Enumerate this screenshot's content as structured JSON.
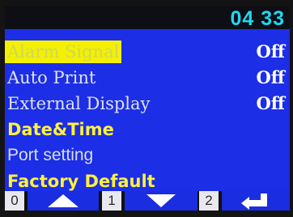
{
  "status": {
    "time": "04 33"
  },
  "menu": {
    "items": [
      {
        "label": "Alarm Signal",
        "value": "Off",
        "selected": true
      },
      {
        "label": "Auto Print",
        "value": "Off"
      },
      {
        "label": "External Display",
        "value": "Off"
      },
      {
        "label": "Date&Time",
        "value": ""
      },
      {
        "label": "Port setting",
        "value": ""
      },
      {
        "label": "Factory Default",
        "value": ""
      }
    ]
  },
  "softkeys": [
    {
      "number": "0",
      "icon": "arrow-up-icon"
    },
    {
      "number": "1",
      "icon": "arrow-down-icon"
    },
    {
      "number": "2",
      "icon": "enter-return-icon"
    }
  ],
  "colors": {
    "screen_background": "#1c2ee6",
    "highlight": "#f4f000",
    "time": "#22d6ef",
    "yellow_text": "#fff13a"
  }
}
